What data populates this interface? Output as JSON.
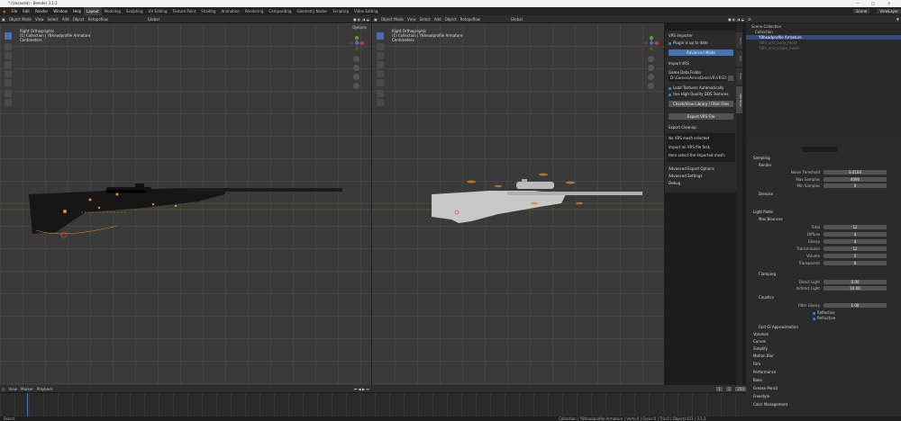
{
  "window": {
    "title": "* (Unsaved) - Blender 3.1.2"
  },
  "menu": [
    "File",
    "Edit",
    "Render",
    "Window",
    "Help"
  ],
  "workspaces": [
    "Layout",
    "Modeling",
    "Sculpting",
    "UV Editing",
    "Texture Paint",
    "Shading",
    "Animation",
    "Rendering",
    "Compositing",
    "Geometry Nodes",
    "Scripting",
    "Video Editing"
  ],
  "top_right": {
    "scene": "Scene",
    "view_layer": "ViewLayer"
  },
  "viewport_header": {
    "mode": "Object Mode",
    "menus": [
      "View",
      "Select",
      "Add",
      "Object"
    ],
    "orientation": "Global",
    "pivot": "Retopoflow",
    "options": "Options"
  },
  "left_viewport": {
    "info": [
      "Right Orthographic",
      "(1) Collection | Y8headprofile Armature",
      "Centimeters"
    ]
  },
  "right_viewport": {
    "info": [
      "Right Orthographic",
      "(1) Collection | Y8headprofile Armature",
      "Centimeters"
    ]
  },
  "npanel": {
    "title": "VRS Importer",
    "status": "Plugin is up to date",
    "install_btn": "Advanced Mode",
    "import_label": "Import VRS",
    "path_label": "Game Data Folder",
    "path_value": "D:\\Games\\Arma\\Data\\VR\\VRSData",
    "opt1": "Load Textures Automatically",
    "opt2": "Use High Quality DDS Textures",
    "check_btn": "Check/View Library / Filter Files",
    "export_btn": "Export VRS File",
    "export_label": "Export Cleanup",
    "msg1": "No VRS mesh selected",
    "msg2": "Import an VRS file first,",
    "msg3": "then select the imported mesh.",
    "adv1": "Advanced Export Options",
    "adv2": "Advanced Settings",
    "adv3": "Debug"
  },
  "npanel_tabs": [
    "Item",
    "Tool",
    "View",
    "VRS Tools"
  ],
  "outliner": {
    "rows": [
      "Scene Collection",
      "Collection",
      "Y8headprofile Armature",
      "Y8hl_vrst_body_mesh",
      "Y8hl_vrst_scope_mesh"
    ]
  },
  "props": {
    "sections": [
      "Sampling",
      "Render",
      "Denoise",
      "Light Paths",
      "Max Bounces",
      "Clamping",
      "Caustics",
      "Fast GI Approximation",
      "Volumes",
      "Curves",
      "Simplify",
      "Motion Blur",
      "Film",
      "Performance",
      "Bake",
      "Grease Pencil",
      "Freestyle",
      "Color Management"
    ],
    "fields": [
      {
        "label": "Noise Threshold",
        "value": "0.0100"
      },
      {
        "label": "Max Samples",
        "value": "4096"
      },
      {
        "label": "Min Samples",
        "value": "0"
      },
      {
        "label": "Total",
        "value": "12"
      },
      {
        "label": "Diffuse",
        "value": "4"
      },
      {
        "label": "Glossy",
        "value": "4"
      },
      {
        "label": "Transmission",
        "value": "12"
      },
      {
        "label": "Volume",
        "value": "0"
      },
      {
        "label": "Transparent",
        "value": "8"
      },
      {
        "label": "Direct Light",
        "value": "0.00"
      },
      {
        "label": "Indirect Light",
        "value": "10.00"
      },
      {
        "label": "Filter Glossy",
        "value": "1.00"
      }
    ],
    "caustics": [
      "Reflective",
      "Refractive"
    ]
  },
  "timeline": {
    "menus": [
      "View",
      "Marker",
      "Playback"
    ],
    "start": "1",
    "end": "250",
    "current": "1"
  },
  "statusbar": {
    "left": "Select",
    "right": "Collection | Y8headprofile Armature | Verts:0 | Faces:0 | Tris:0 | Objects:0/3 | 3.1.2"
  }
}
